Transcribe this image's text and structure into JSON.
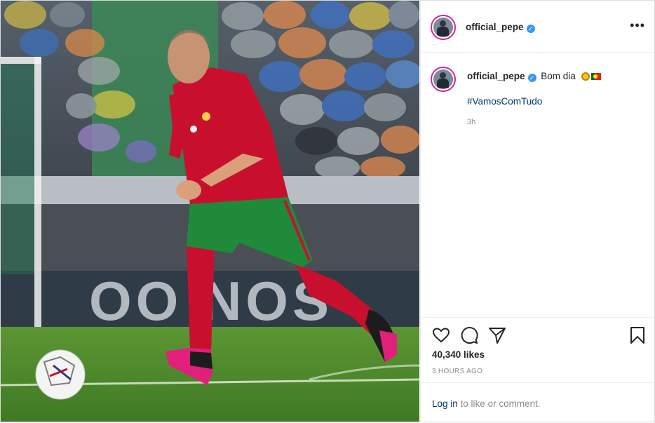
{
  "post": {
    "username": "official_pepe",
    "verified_glyph": "✓",
    "more_label": "•••",
    "caption_text": "Bom dia",
    "caption_emojis": [
      "sun-emoji",
      "portugal-flag-emoji"
    ],
    "hashtag": "#VamosComTudo",
    "relative_time": "3h",
    "likes": "40,340 likes",
    "posted_ago": "3 HOURS AGO",
    "photo_background_text": "OO NOS"
  },
  "actions": {
    "icons": [
      "heart-icon",
      "comment-icon",
      "share-icon",
      "bookmark-icon"
    ]
  },
  "login": {
    "link_text": "Log in",
    "rest_text": " to like or comment."
  },
  "colors": {
    "shirt_red": "#c8102e",
    "shorts_green": "#1f8a3a",
    "pitch_green": "#4f8a2c",
    "link_blue": "#00376b",
    "verified_blue": "#3897f0",
    "muted_gray": "#8e8e8e"
  }
}
